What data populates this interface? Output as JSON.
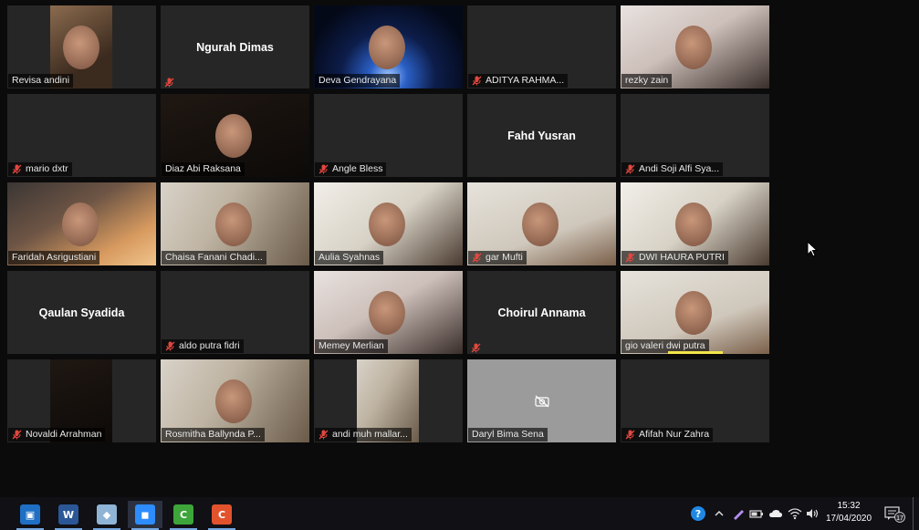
{
  "participants": [
    {
      "name": "Revisa andini",
      "video": "portrait",
      "muted": false,
      "active": false
    },
    {
      "name": "Ngurah Dimas",
      "video": "none",
      "muted": true,
      "active": false
    },
    {
      "name": "Deva Gendrayana",
      "video": "full",
      "muted": false,
      "active": true
    },
    {
      "name": "ADITYA RAHMA...",
      "video": "none",
      "muted": true,
      "active": false
    },
    {
      "name": "rezky zain",
      "video": "full",
      "muted": false,
      "active": false
    },
    {
      "name": "mario dxtr",
      "video": "none",
      "muted": true,
      "active": false
    },
    {
      "name": "Diaz Abi Raksana",
      "video": "full",
      "muted": false,
      "active": false
    },
    {
      "name": "Angle Bless",
      "video": "none",
      "muted": true,
      "active": false
    },
    {
      "name": "Fahd Yusran",
      "video": "none",
      "muted": false,
      "active": false
    },
    {
      "name": "Andi Soji Alfi Sya...",
      "video": "none",
      "muted": true,
      "active": false
    },
    {
      "name": "Faridah Asrigustiani",
      "video": "full",
      "muted": false,
      "active": false
    },
    {
      "name": "Chaisa Fanani Chadi...",
      "video": "full",
      "muted": false,
      "active": false
    },
    {
      "name": "Aulia Syahnas",
      "video": "full",
      "muted": false,
      "active": false
    },
    {
      "name": "gar Mufti",
      "video": "full",
      "muted": true,
      "active": false
    },
    {
      "name": "DWI HAURA PUTRI",
      "video": "full",
      "muted": true,
      "active": false
    },
    {
      "name": "Qaulan Syadida",
      "video": "none",
      "muted": false,
      "active": false
    },
    {
      "name": "aldo putra fidri",
      "video": "none",
      "muted": true,
      "active": false
    },
    {
      "name": "Memey Merlian",
      "video": "full",
      "muted": false,
      "active": false
    },
    {
      "name": "Choirul Annama",
      "video": "none",
      "muted": true,
      "active": false
    },
    {
      "name": "gio valeri dwi putra",
      "video": "full",
      "muted": false,
      "active": false,
      "speaking": true
    },
    {
      "name": "Novaldi Arrahman",
      "video": "portrait",
      "muted": true,
      "active": false
    },
    {
      "name": "Rosmitha Ballynda P...",
      "video": "full",
      "muted": false,
      "active": false
    },
    {
      "name": "andi muh mallar...",
      "video": "portrait",
      "muted": true,
      "active": false
    },
    {
      "name": "Daryl Bima Sena",
      "video": "off",
      "muted": false,
      "active": false
    },
    {
      "name": "Afifah Nur Zahra",
      "video": "none",
      "muted": true,
      "active": false
    }
  ],
  "taskbar": {
    "apps": [
      {
        "name": "virtualbox-icon",
        "glyph": "▣",
        "color": "#1f6fc4"
      },
      {
        "name": "word-icon",
        "glyph": "W",
        "color": "#2b5797"
      },
      {
        "name": "notes-icon",
        "glyph": "◆",
        "color": "#8fb4d6"
      },
      {
        "name": "zoom-icon",
        "glyph": "◼",
        "color": "#2d8cff"
      },
      {
        "name": "camtasia-icon",
        "glyph": "C",
        "color": "#3da53a"
      },
      {
        "name": "present-icon",
        "glyph": "C",
        "color": "#e2532d"
      }
    ],
    "clock_time": "15:32",
    "clock_date": "17/04/2020",
    "notification_count": "17"
  },
  "colors": {
    "active_border": "#d9e66a",
    "mute_red": "#e0473e",
    "speaking_bar": "#f3e64a",
    "tile_bg": "#262626"
  }
}
